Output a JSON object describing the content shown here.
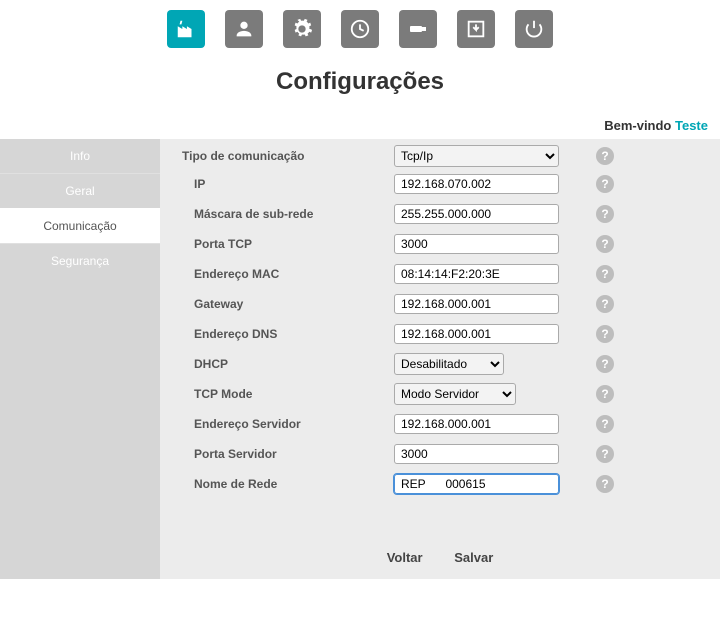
{
  "page": {
    "title": "Configurações",
    "welcome_prefix": "Bem-vindo ",
    "welcome_user": "Teste"
  },
  "top_icons": [
    {
      "name": "factory-icon",
      "active": true
    },
    {
      "name": "user-icon",
      "active": false
    },
    {
      "name": "gear-icon",
      "active": false
    },
    {
      "name": "clock-icon",
      "active": false
    },
    {
      "name": "usb-icon",
      "active": false
    },
    {
      "name": "download-icon",
      "active": false
    },
    {
      "name": "power-icon",
      "active": false
    }
  ],
  "sidebar": {
    "items": [
      {
        "label": "Info",
        "active": false
      },
      {
        "label": "Geral",
        "active": false
      },
      {
        "label": "Comunicação",
        "active": true
      },
      {
        "label": "Segurança",
        "active": false
      }
    ]
  },
  "form": {
    "tipo_comunicacao": {
      "label": "Tipo de comunicação",
      "value": "Tcp/Ip"
    },
    "ip": {
      "label": "IP",
      "value": "192.168.070.002"
    },
    "mascara": {
      "label": "Máscara de sub-rede",
      "value": "255.255.000.000"
    },
    "porta_tcp": {
      "label": "Porta TCP",
      "value": "3000"
    },
    "mac": {
      "label": "Endereço MAC",
      "value": "08:14:14:F2:20:3E"
    },
    "gateway": {
      "label": "Gateway",
      "value": "192.168.000.001"
    },
    "dns": {
      "label": "Endereço DNS",
      "value": "192.168.000.001"
    },
    "dhcp": {
      "label": "DHCP",
      "value": "Desabilitado"
    },
    "tcp_mode": {
      "label": "TCP Mode",
      "value": "Modo Servidor"
    },
    "end_servidor": {
      "label": "Endereço Servidor",
      "value": "192.168.000.001"
    },
    "porta_servidor": {
      "label": "Porta Servidor",
      "value": "3000"
    },
    "nome_rede": {
      "label": "Nome de Rede",
      "value": "REP      000615"
    }
  },
  "footer": {
    "back": "Voltar",
    "save": "Salvar"
  },
  "help_symbol": "?"
}
